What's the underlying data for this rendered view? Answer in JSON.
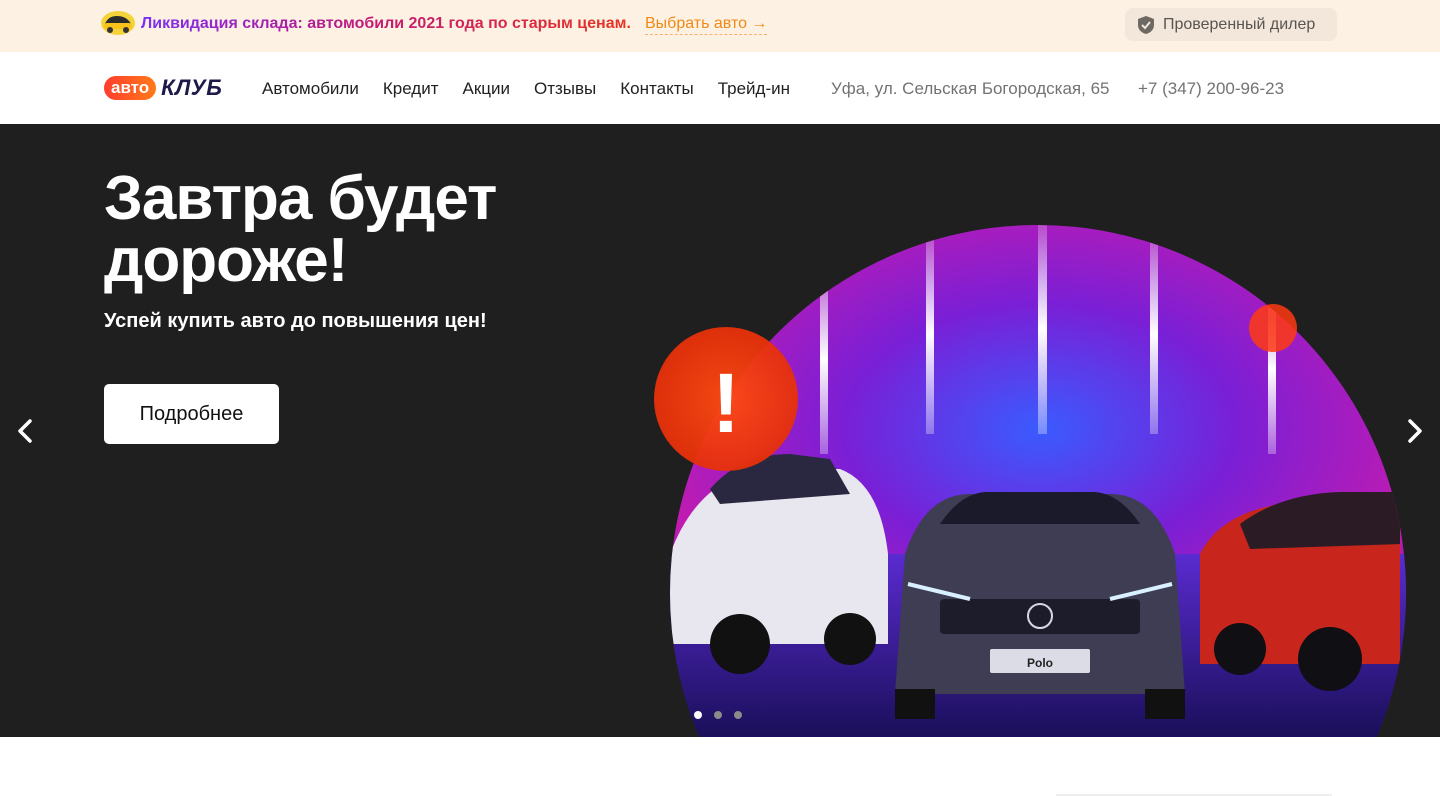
{
  "promo": {
    "text": "Ликвидация склада: автомобили 2021 года по старым ценам.",
    "link": "Выбрать авто →",
    "icon": "car-emoji-icon",
    "badge_icon": "shield-check-icon",
    "badge": "Проверенный дилер"
  },
  "header": {
    "logo_pill": "авто",
    "logo_word": "КЛУБ",
    "nav": [
      "Автомобили",
      "Кредит",
      "Акции",
      "Отзывы",
      "Контакты",
      "Трейд-ин"
    ],
    "address": "Уфа, ул. Сельская Богородская, 65",
    "phone": "+7 (347) 200-96-23"
  },
  "hero": {
    "title": "Завтра будет дороже!",
    "subtitle": "Успей купить авто до повышения цен!",
    "button": "Подробнее",
    "exclamation": "!",
    "plate": "Polo",
    "slides_total": 3,
    "active_slide": 1
  },
  "colors": {
    "hero_bg": "#1f1f1f",
    "promo_bg": "#fdf1e3",
    "accent_orange": "#f08a16",
    "badge_red": "#ff3a12"
  }
}
